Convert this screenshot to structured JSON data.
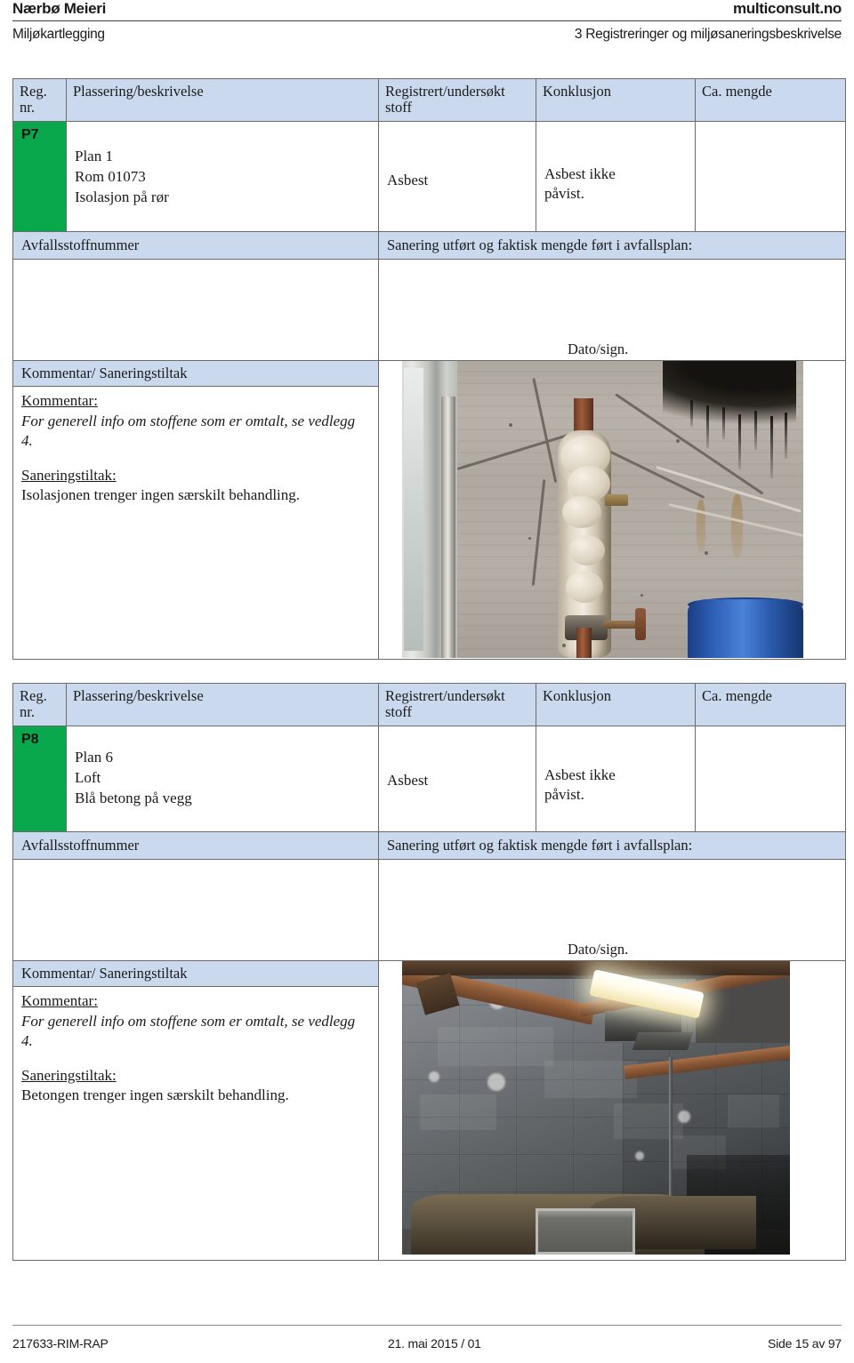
{
  "header": {
    "project_title": "Nærbø Meieri",
    "company": "multiconsult.no",
    "subtitle_left": "Miljøkartlegging",
    "subtitle_right": "3 Registreringer og miljøsaneringsbeskrivelse"
  },
  "columns": {
    "reg_nr_line1": "Reg.",
    "reg_nr_line2": "nr.",
    "plassering": "Plassering/beskrivelse",
    "stoff_line1": "Registrert/undersøkt",
    "stoff_line2": "stoff",
    "konklusjon": "Konklusjon",
    "mengde": "Ca. mengde"
  },
  "labels": {
    "avfallsstoffnummer": "Avfallsstoffnummer",
    "sanering_utfort": "Sanering utført og faktisk mengde ført i avfallsplan:",
    "dato_sign": "Dato/sign.",
    "kommentar_banner": "Kommentar/ Saneringstiltak",
    "kommentar_heading": "Kommentar:",
    "saneringstiltak_heading": "Saneringstiltak:"
  },
  "colors": {
    "reg_green": "#0aa84d",
    "header_blue": "#cbd9ef",
    "border_gray": "#6b6b6b"
  },
  "records": [
    {
      "reg_nr": "P7",
      "plassering": [
        "Plan 1",
        "Rom 01073",
        "Isolasjon på rør"
      ],
      "stoff": "Asbest",
      "konklusjon": [
        "Asbest ikke",
        "påvist."
      ],
      "mengde": "",
      "avfallsstoffnummer_value": "",
      "sanering_value": "",
      "kommentar_text": "For generell info om stoffene som er omtalt, se vedlegg 4.",
      "saneringstiltak_text": "Isolasjonen trenger ingen særskilt behandling.",
      "photo_name": "photo-pipe-insulation"
    },
    {
      "reg_nr": "P8",
      "plassering": [
        "Plan 6",
        "Loft",
        "Blå betong på vegg"
      ],
      "stoff": "Asbest",
      "konklusjon": [
        "Asbest ikke",
        "påvist."
      ],
      "mengde": "",
      "avfallsstoffnummer_value": "",
      "sanering_value": "",
      "kommentar_text": "For generell info om stoffene som er omtalt, se vedlegg 4.",
      "saneringstiltak_text": "Betongen trenger ingen særskilt behandling.",
      "photo_name": "photo-attic-blue-concrete-wall"
    }
  ],
  "footer": {
    "doc_id": "217633-RIM-RAP",
    "date_rev": "21. mai 2015 / 01",
    "page": "Side 15 av 97"
  }
}
